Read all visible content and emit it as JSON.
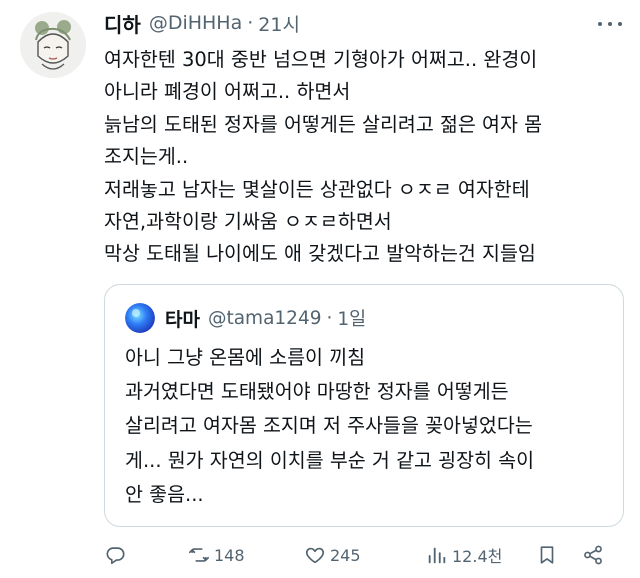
{
  "author": {
    "display_name": "디하",
    "handle": "@DiHHHa",
    "separator": "·",
    "time": "21시"
  },
  "tweet_lines": [
    "여자한텐 30대 중반 넘으면 기형아가 어쩌고.. 완경이",
    "아니라 폐경이 어쩌고.. 하면서",
    "늙남의 도태된 정자를 어떻게든 살리려고 젊은 여자 몸",
    "조지는게..",
    "저래놓고 남자는 몇살이든 상관없다 ㅇㅈㄹ 여자한테",
    "자연,과학이랑 기싸움 ㅇㅈㄹ하면서",
    "막상 도태될 나이에도 애 갖겠다고 발악하는건 지들임"
  ],
  "quoted": {
    "display_name": "타마",
    "handle": "@tama1249",
    "separator": "·",
    "time": "1일",
    "lines": [
      "아니 그냥 온몸에 소름이 끼침",
      "과거였다면 도태됐어야 마땅한 정자를 어떻게든",
      "살리려고 여자몸 조지며 저 주사들을 꽂아넣었다는",
      "게... 뭔가 자연의 이치를 부순 거 같고 굉장히 속이",
      "안 좋음..."
    ]
  },
  "actions": {
    "reply_icon": "reply-icon",
    "retweet_icon": "retweet-icon",
    "retweet_count": "148",
    "like_icon": "heart-icon",
    "like_count": "245",
    "views_icon": "views-icon",
    "views_count": "12.4천",
    "bookmark_icon": "bookmark-icon",
    "share_icon": "share-icon"
  },
  "colors": {
    "text": "#0f1419",
    "secondary": "#536471",
    "border": "#cfd9de",
    "background": "#ffffff"
  }
}
